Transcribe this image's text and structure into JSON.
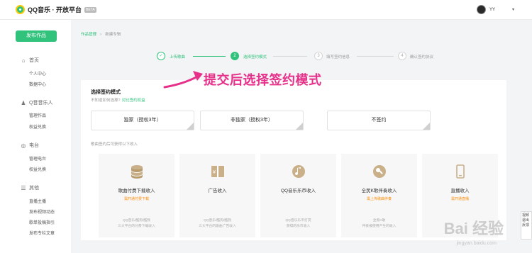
{
  "header": {
    "logo_text": "QQ音乐 · 开放平台",
    "logo_badge": "BETA",
    "user_name": "YY",
    "caret": "▾"
  },
  "sidebar": {
    "publish_label": "发布作品",
    "sections": [
      {
        "label": "首页",
        "icon": "home-icon",
        "glyph": "⌂",
        "items": [
          "个人中心",
          "数据中心"
        ]
      },
      {
        "label": "Q音音乐人",
        "icon": "user-icon",
        "glyph": "♟",
        "items": [
          "管理作品",
          "权益兑换"
        ]
      },
      {
        "label": "电台",
        "icon": "radio-icon",
        "glyph": "◎",
        "items": [
          "管理电台",
          "权益兑换"
        ]
      },
      {
        "label": "其他",
        "icon": "menu-icon",
        "glyph": "☰",
        "items": [
          "直播主播",
          "发布视频动态",
          "歌单投稿指引",
          "发布专栏文章"
        ]
      }
    ]
  },
  "breadcrumb": {
    "parent": "作品管理",
    "sep": ">",
    "current": "新建专辑"
  },
  "steps": [
    {
      "num": "✓",
      "label": "上传歌曲",
      "state": "done"
    },
    {
      "num": "2",
      "label": "选择签约模式",
      "state": "active"
    },
    {
      "num": "3",
      "label": "填写签约信息",
      "state": "todo"
    },
    {
      "num": "4",
      "label": "确认签约协议",
      "state": "todo"
    }
  ],
  "annotation": {
    "text": "提交后选择签约模式",
    "color": "#e6308a"
  },
  "contract": {
    "title": "选择签约模式",
    "subtitle": "不知道如何选择?",
    "subtitle_link": "对比签约权益",
    "options": [
      "独家（授权3年）",
      "非独家（授权3年）",
      "不签约"
    ],
    "income_hint": "歌曲签约后可获得以下收入"
  },
  "income_cards": [
    {
      "icon": "coins-icon",
      "title": "歌曲付费下载收入",
      "highlight": "需开通付费下载",
      "desc1": "QQ音乐/酷狗/酷我",
      "desc2": "三大平台的付费下载收入"
    },
    {
      "icon": "ad-icon",
      "title": "广告收入",
      "highlight": "",
      "desc1": "QQ音乐/酷狗/酷我",
      "desc2": "三大平台的歌曲广告收入"
    },
    {
      "icon": "coin-music-icon",
      "title": "QQ音乐乐币收入",
      "highlight": "",
      "desc1": "QQ音乐乐币打赏",
      "desc2": "获得的乐币收入"
    },
    {
      "icon": "karaoke-icon",
      "title": "全民K歌伴奏收入",
      "highlight": "需上传歌曲伴奏",
      "desc1": "全民K歌",
      "desc2": "伴奏被使用产生的收入"
    },
    {
      "icon": "live-icon",
      "title": "直播收入",
      "highlight": "需开通直播",
      "desc1": "",
      "desc2": ""
    }
  ],
  "watermark": {
    "text": "Bai 经验",
    "url": "jingyan.baidu.com"
  },
  "side_ad": "视频 退出 反馈",
  "colors": {
    "accent": "#31c27c",
    "annotation": "#e6308a",
    "highlight": "#ff8a00"
  }
}
